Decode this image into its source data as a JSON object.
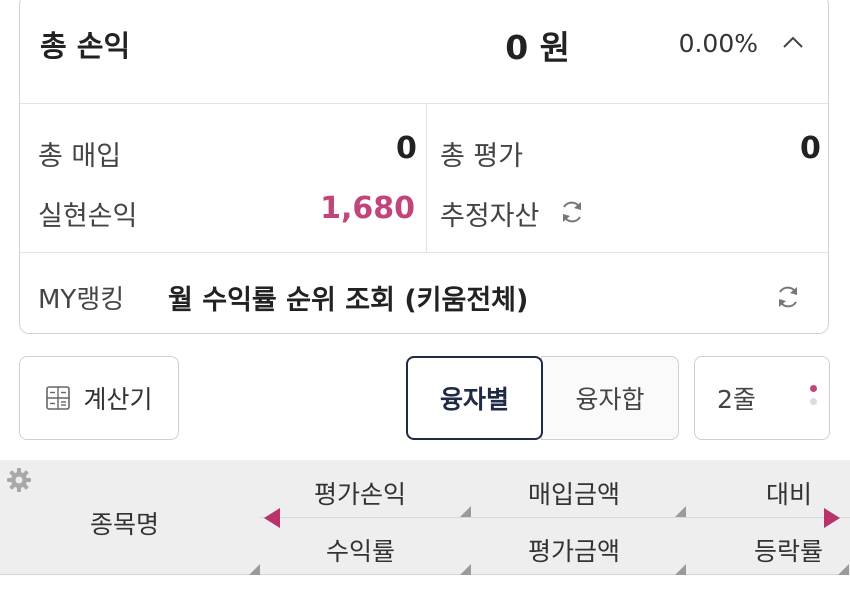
{
  "summary": {
    "total_pl_label": "총 손익",
    "total_pl_value": "0 원",
    "total_pl_rate": "0.00%",
    "purchase_label": "총 매입",
    "purchase_value": "0",
    "evaluation_label": "총 평가",
    "evaluation_value": "0",
    "realized_label": "실현손익",
    "realized_value": "1,680",
    "estimated_assets_label": "추정자산"
  },
  "ranking": {
    "label": "MY랭킹",
    "text": "월 수익률 순위 조회 (키움전체)"
  },
  "toolbar": {
    "calculator_label": "계산기",
    "by_loan_label": "융자별",
    "loan_sum_label": "융자합",
    "rows_label": "2줄"
  },
  "table_header": {
    "name": "종목명",
    "eval_pl": "평가손익",
    "purchase_amount": "매입금액",
    "compare": "대비",
    "return_rate": "수익률",
    "eval_amount": "평가금액",
    "change_rate": "등락률"
  },
  "colors": {
    "accent_pink": "#c0457a",
    "selected_border": "#1f2a44",
    "header_bg": "#eeeeee"
  },
  "icons": [
    "chevron-up-icon",
    "refresh-icon",
    "calculator-icon",
    "more-dots-icon",
    "gear-icon",
    "arrow-left-icon",
    "arrow-right-icon"
  ]
}
